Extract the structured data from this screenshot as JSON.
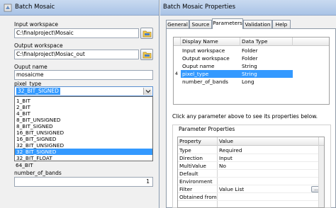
{
  "left": {
    "title": "Batch Mosaic",
    "input_workspace_label": "Input workspace",
    "input_workspace_value": "C:\\finalproject\\Mosaic",
    "output_workspace_label": "Output workspace",
    "output_workspace_value": "C:\\finalproject\\Mosiac_out",
    "output_name_label": "Ouput name",
    "output_name_value": "mosaicme",
    "pixel_type_label": "pixel_type",
    "pixel_type_selected": "32_BIT_SIGNED",
    "pixel_type_options": [
      "1_BIT",
      "2_BIT",
      "4_BIT",
      "8_BIT_UNSIGNED",
      "8_BIT_SIGNED",
      "16_BIT_UNSIGNED",
      "16_BIT_SIGNED",
      "32_BIT_UNSIGNED",
      "32_BIT_SIGNED",
      "32_BIT_FLOAT",
      "64_BIT"
    ],
    "number_of_bands_label": "number_of_bands",
    "number_of_bands_value": "1"
  },
  "right": {
    "title": "Batch Mosaic Properties",
    "tabs": [
      "General",
      "Source",
      "Parameters",
      "Validation",
      "Help"
    ],
    "active_tab": "Parameters",
    "params_headers": [
      "Display Name",
      "Data Type"
    ],
    "params": [
      {
        "name": "Input workspace",
        "type": "Folder"
      },
      {
        "name": "Output workspace",
        "type": "Folder"
      },
      {
        "name": "Ouput name",
        "type": "String"
      },
      {
        "name": "pixel_type",
        "type": "String"
      },
      {
        "name": "number_of_bands",
        "type": "Long"
      }
    ],
    "selected_row_marker": "4",
    "hint": "Click any parameter above to see its properties below.",
    "props_title": "Parameter Properties",
    "props_headers": [
      "Property",
      "Value"
    ],
    "props": [
      {
        "name": "Type",
        "value": "Required"
      },
      {
        "name": "Direction",
        "value": "Input"
      },
      {
        "name": "MultiValue",
        "value": "No"
      },
      {
        "name": "Default",
        "value": ""
      },
      {
        "name": "Environment",
        "value": ""
      },
      {
        "name": "Filter",
        "value": "Value List"
      },
      {
        "name": "Obtained from",
        "value": ""
      }
    ],
    "ellipsis_label": "..."
  },
  "colors": {
    "selection": "#3399ff",
    "title_gradient": "#b9cfee"
  }
}
